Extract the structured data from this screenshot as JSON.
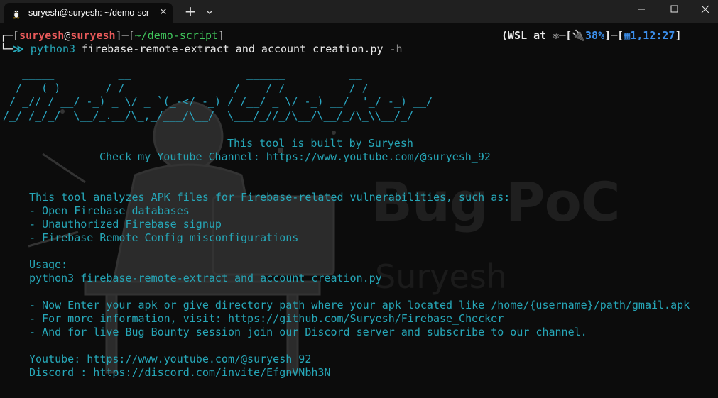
{
  "titlebar": {
    "tab_title": "suryesh@suryesh: ~/demo-scri",
    "tab_icon": "linux-penguin-icon",
    "new_tab_label": "+",
    "close_label": "✕"
  },
  "prompt": {
    "user": "suryesh",
    "at": "@",
    "host": "suryesh",
    "dir": "~/demo-script",
    "command": "python3",
    "script": "firebase-remote-extract_and_account_creation.py",
    "flag": "-h"
  },
  "status": {
    "wsl": "(WSL at ",
    "battery": "38%",
    "time": "1,12:27"
  },
  "banner": [
    "   _____          __                  ______          __",
    "  / __(_)______ / /  ___ ____ ___   / ___/ /  ___ ____/ /_____ ____",
    " / _// / __/ -_) _ \\/ _ `(_-</ -_) / /__/ _ \\/ -_) __/  '_/ -_) __/",
    "/_/ /_/_/  \\__/_.__/\\_,_/___/\\__/  \\___/_//_/\\__/\\__/_/\\_\\\\__/_/"
  ],
  "credits": {
    "built_by": "This tool is built by Suryesh",
    "channel": "Check my Youtube Channel: https://www.youtube.com/@suryesh_92"
  },
  "description": {
    "intro": "This tool analyzes APK files for Firebase-related vulnerabilities, such as:",
    "items": [
      "- Open Firebase databases",
      "- Unauthorized Firebase signup",
      "- Firebase Remote Config misconfigurations"
    ]
  },
  "usage": {
    "label": "Usage:",
    "command": "python3 firebase-remote-extract_and_account_creation.py"
  },
  "notes": [
    "- Now Enter your apk or give directory path where your apk located like /home/{username}/path/gmail.apk",
    "- For more information, visit: https://github.com/Suryesh/Firebase_Checker",
    "- And for live Bug Bounty session join our Discord server and subscribe to our channel."
  ],
  "links": {
    "youtube": "Youtube: https://www.youtube.com/@suryesh_92",
    "discord": "Discord : https://discord.com/invite/EfgnVNbh3N"
  },
  "watermark": {
    "title": "Bug PoC",
    "subtitle": "Suryesh"
  },
  "colors": {
    "background": "#0c0c0c",
    "accent_cyan": "#26a7b8",
    "prompt_green": "#3fc25a",
    "prompt_red": "#e85a5a"
  }
}
